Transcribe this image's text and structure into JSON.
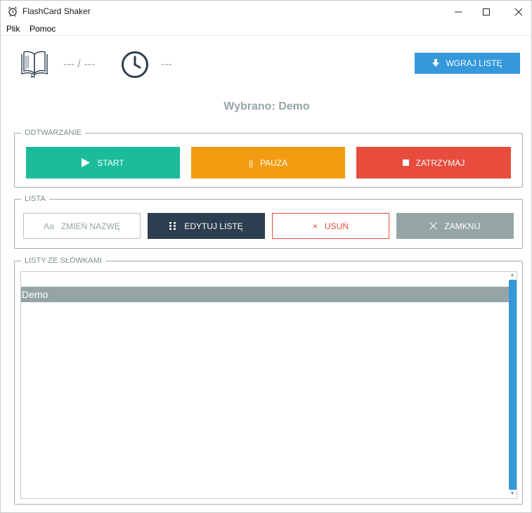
{
  "window": {
    "title": "FlashCard Shaker",
    "controls": {
      "minimize": "—",
      "maximize": "☐",
      "close": "✕"
    }
  },
  "menu": {
    "items": [
      "Plik",
      "Pomoc"
    ]
  },
  "header": {
    "progress": "--- / ---",
    "time": "---",
    "upload_button": "WGRAJ LISTĘ"
  },
  "selected": "Wybrano: Demo",
  "playback": {
    "label": "ODTWARZANIE",
    "start": "START",
    "pause_icon": "||",
    "pause": "PAUZA",
    "stop": "ZATRZYMAJ"
  },
  "list": {
    "label": "LISTA",
    "rename_icon": "Aa",
    "rename": "ZMIEŃ NAZWĘ",
    "edit": "EDYTUJ LISTĘ",
    "delete_icon": "×",
    "delete": "USUŃ",
    "close": "ZAMKNIJ"
  },
  "wordlists": {
    "label": "LISTY ZE SŁÓWKAMI",
    "items": [
      "Demo"
    ],
    "scroll_up": "▲",
    "scroll_down": "▼"
  },
  "colors": {
    "accent_blue": "#3498db",
    "start_green": "#1abc9c",
    "pause_orange": "#f39c12",
    "stop_red": "#e74c3c",
    "dark_navy": "#2c3e50",
    "gray": "#95a5a6"
  }
}
